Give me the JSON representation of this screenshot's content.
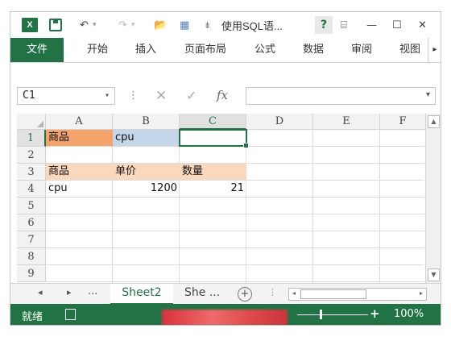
{
  "titlebar": {
    "app_icon_label": "X",
    "title": "使用SQL语...",
    "help": "?",
    "ribbon_display": "⌸",
    "minimize": "—",
    "maximize": "☐",
    "close": "✕",
    "undo": "↶",
    "redo": "↷",
    "open": "📂",
    "customize": "⇟"
  },
  "ribbon": {
    "tabs": [
      "文件",
      "开始",
      "插入",
      "页面布局",
      "公式",
      "数据",
      "审阅",
      "视图"
    ],
    "more": "▸"
  },
  "formula_bar": {
    "name_box": "C1",
    "dropdown": "▾",
    "separator": "⋮",
    "cancel": "✕",
    "enter": "✓",
    "fx": "fx",
    "content": ""
  },
  "grid": {
    "columns": [
      "A",
      "B",
      "C",
      "D",
      "E",
      "F"
    ],
    "rows": [
      "1",
      "2",
      "3",
      "4",
      "5",
      "6",
      "7",
      "8",
      "9"
    ],
    "cells": {
      "A1": "商品",
      "B1": "cpu",
      "A3": "商品",
      "B3": "单价",
      "C3": "数量",
      "A4": "cpu",
      "B4": "1200",
      "C4": "21"
    },
    "selected_cell": "C1",
    "colors": {
      "A1_fill": "#f4a46a",
      "B1_fill": "#c5d5ea",
      "row3_fill": "#fad8be",
      "accent": "#217346"
    }
  },
  "sheet_tabs": {
    "prev": "◂",
    "next": "▸",
    "more": "...",
    "active": "Sheet2",
    "inactive": "She ...",
    "add": "+"
  },
  "status": {
    "ready": "就绪",
    "zoom": "100%",
    "zoom_plus": "+"
  }
}
